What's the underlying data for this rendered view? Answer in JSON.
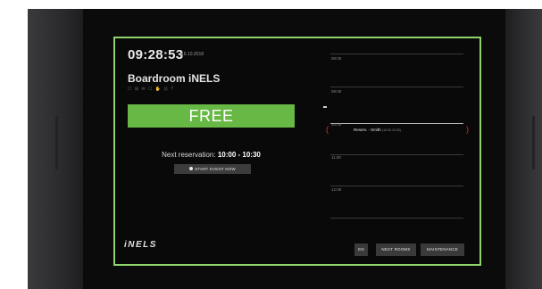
{
  "header": {
    "time": "09:28:53",
    "date": "16.10.2018"
  },
  "room": {
    "name": "Boardroom iNELS",
    "equipment_icons": "☐ ⊞ ✉ ☐ ✋ ⊡ ?"
  },
  "status": {
    "label": "FREE",
    "color": "#67b845"
  },
  "next_reservation": {
    "label": "Next reservation:",
    "time_range": "10:00 - 10:30"
  },
  "actions": {
    "start_event": "START EVENT NOW"
  },
  "timeline": {
    "slots": [
      "08:00",
      "09:00",
      "10:00",
      "11:00",
      "12:00"
    ],
    "reservation": {
      "title": "Reserv. - Smith",
      "time_small": "(10:00-10:30)"
    }
  },
  "footer": {
    "logo": "iNELS",
    "language": "EN",
    "next_rooms": "NEXT ROOMS",
    "maintenance": "MAINTENANCE"
  },
  "colors": {
    "accent": "#8ed46a",
    "free": "#67b845",
    "reservation_bracket": "#d43a3a"
  },
  "icons": {
    "start_event": "record-dot-icon",
    "now_marker": "current-time-marker-icon"
  }
}
